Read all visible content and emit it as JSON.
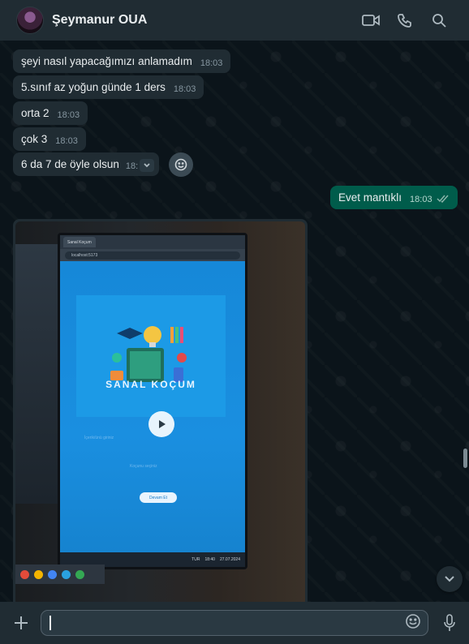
{
  "header": {
    "contact_name": "Şeymanur OUA",
    "icons": [
      "video-call-icon",
      "voice-call-icon",
      "search-icon"
    ]
  },
  "messages": [
    {
      "text": "şeyi nasıl yapacağımızı anlamadım",
      "time": "18:03",
      "direction": "in"
    },
    {
      "text": "5.sınıf az yoğun günde 1 ders",
      "time": "18:03",
      "direction": "in"
    },
    {
      "text": "orta 2",
      "time": "18:03",
      "direction": "in"
    },
    {
      "text": "çok 3",
      "time": "18:03",
      "direction": "in"
    },
    {
      "text": "6 da 7 de öyle olsun",
      "time": "18:",
      "direction": "in"
    },
    {
      "text": "Evet mantıklı",
      "time": "18:03",
      "direction": "out",
      "status": "read"
    }
  ],
  "video": {
    "tab_label": "Sanal Koçum",
    "url": "localhost:5173",
    "hero_title": "SANAL KOÇUM",
    "field1": "İçerik/ünü giriniz",
    "field2": "Koçunu seçiniz",
    "button": "Devam Et",
    "taskbar_lang": "TUR",
    "taskbar_time": "18:40",
    "taskbar_date": "27.07.2024"
  },
  "composer": {
    "placeholder": ""
  },
  "colors": {
    "incoming_bubble": "#202c33",
    "outgoing_bubble": "#005c4b",
    "background": "#0b141a"
  }
}
